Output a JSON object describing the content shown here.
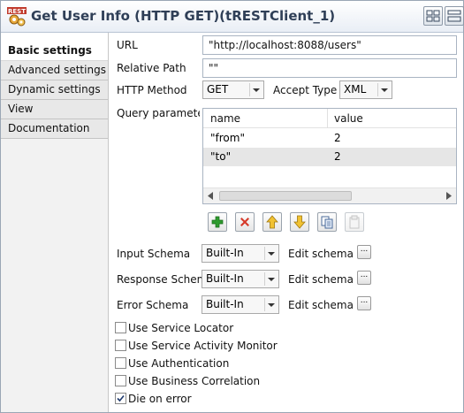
{
  "window": {
    "title": "Get User Info (HTTP GET)(tRESTClient_1)",
    "icon": "talend-rest-component-icon",
    "icon_badge": "REST"
  },
  "tabs": [
    {
      "label": "Basic settings",
      "active": true
    },
    {
      "label": "Advanced settings",
      "active": false
    },
    {
      "label": "Dynamic settings",
      "active": false
    },
    {
      "label": "View",
      "active": false
    },
    {
      "label": "Documentation",
      "active": false
    }
  ],
  "form": {
    "url_label": "URL",
    "url_value": "\"http://localhost:8088/users\"",
    "relative_path_label": "Relative Path",
    "relative_path_value": "\"\"",
    "http_method_label": "HTTP Method",
    "http_method_value": "GET",
    "accept_type_label": "Accept Type",
    "accept_type_value": "XML",
    "query_params_label": "Query parameters"
  },
  "query_table": {
    "columns": [
      "name",
      "value"
    ],
    "rows": [
      {
        "name": "\"from\"",
        "value": "2",
        "selected": false
      },
      {
        "name": "\"to\"",
        "value": "2",
        "selected": true
      }
    ]
  },
  "table_toolbar": [
    "add-icon",
    "delete-icon",
    "move-up-icon",
    "move-down-icon",
    "copy-icon",
    "paste-icon"
  ],
  "schemas": [
    {
      "label": "Input Schema",
      "value": "Built-In",
      "edit_label": "Edit schema",
      "edit_button": "..."
    },
    {
      "label": "Response Schema",
      "value": "Built-In",
      "edit_label": "Edit schema",
      "edit_button": "..."
    },
    {
      "label": "Error Schema",
      "value": "Built-In",
      "edit_label": "Edit schema",
      "edit_button": "..."
    }
  ],
  "options": [
    {
      "label": "Use Service Locator",
      "checked": false
    },
    {
      "label": "Use Service Activity Monitor",
      "checked": false
    },
    {
      "label": "Use Authentication",
      "checked": false
    },
    {
      "label": "Use Business Correlation",
      "checked": false
    },
    {
      "label": "Die on error",
      "checked": true
    }
  ],
  "colors": {
    "title": "#2f3f57",
    "selected_row": "#e6e6e6",
    "add": "#2e9b2e",
    "delete": "#d63a2a",
    "arrow": "#e8b220"
  }
}
